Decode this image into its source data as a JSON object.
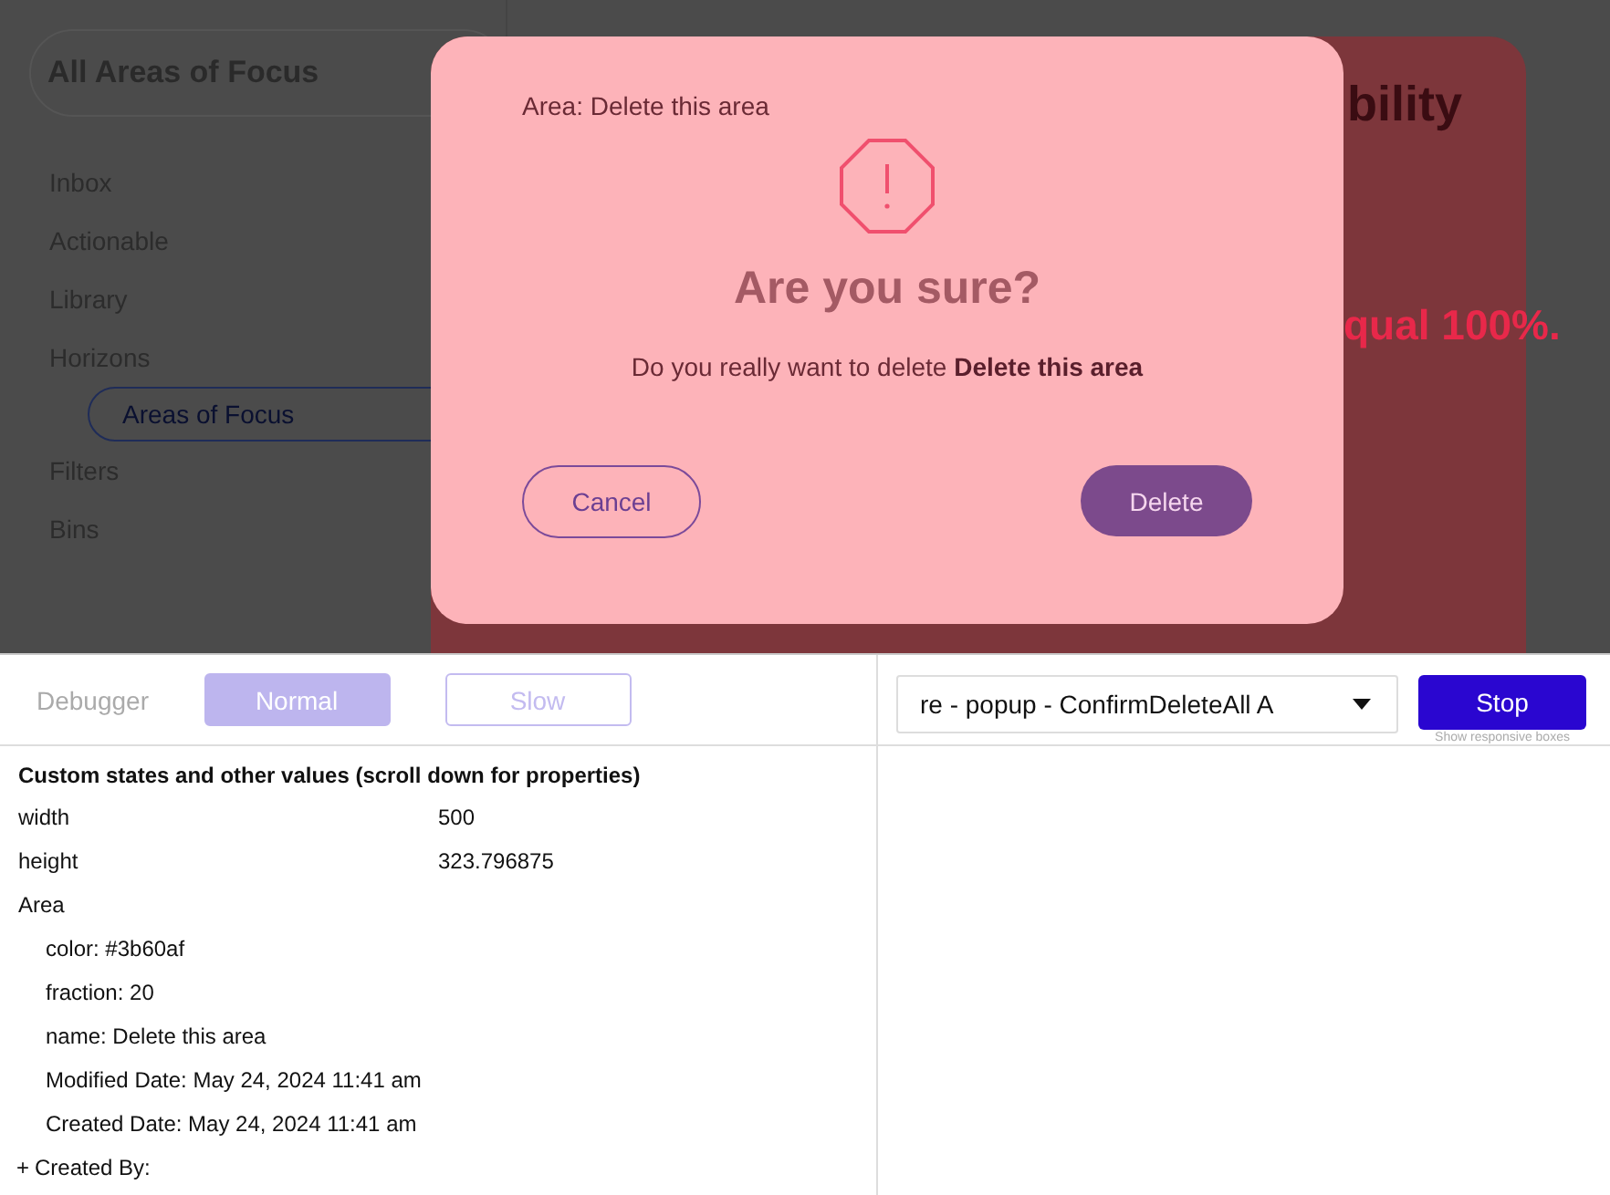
{
  "sidebar": {
    "filter_field": {
      "value": "All Areas of Focus"
    },
    "items": [
      {
        "label": "Inbox",
        "selected": false
      },
      {
        "label": "Actionable",
        "selected": false
      },
      {
        "label": "Library",
        "selected": false
      },
      {
        "label": "Horizons",
        "selected": false,
        "children": [
          {
            "label": "Areas of Focus",
            "selected": true
          }
        ]
      },
      {
        "label": "Filters",
        "selected": false
      },
      {
        "label": "Bins",
        "selected": false
      }
    ]
  },
  "background": {
    "heading_fragment": "bility",
    "text_fragment": "qual 100%."
  },
  "dialog": {
    "caption": "Area: Delete this area",
    "title": "Are you sure?",
    "message": "Do you really want to delete **Delete this area**",
    "buttons": [
      {
        "label": "Cancel",
        "kind": "secondary"
      },
      {
        "label": "Delete",
        "kind": "primary"
      }
    ]
  },
  "debugger": {
    "label": "Debugger",
    "speed_buttons": [
      {
        "label": "Normal",
        "selected": true
      },
      {
        "label": "Slow",
        "selected": false
      }
    ],
    "element_select": {
      "value": "re - popup - ConfirmDeleteAll A"
    },
    "stop_button": "Stop",
    "hint": "Show responsive boxes",
    "properties": {
      "heading": "Custom states and other values (scroll down for properties)",
      "rows": [
        {
          "label": "width",
          "value": "500"
        },
        {
          "label": "height",
          "value": "323.796875"
        },
        {
          "label": "Area",
          "children": [
            {
              "label": "color: #3b60af"
            },
            {
              "label": "fraction: 20"
            },
            {
              "label": "name: Delete this area"
            },
            {
              "label": "Modified Date: May 24, 2024 11:41 am"
            },
            {
              "label": "Created Date: May 24, 2024 11:41 am"
            }
          ]
        },
        {
          "label": "Created By:",
          "toggle": "+"
        }
      ]
    }
  }
}
